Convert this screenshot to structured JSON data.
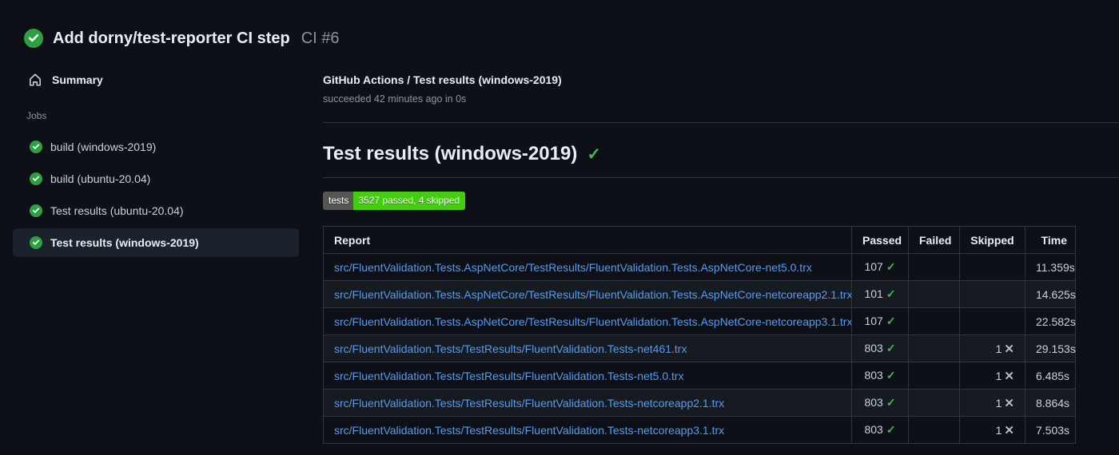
{
  "header": {
    "title": "Add dorny/test-reporter CI step",
    "run_label": "CI #6",
    "status": "success"
  },
  "sidebar": {
    "summary_label": "Summary",
    "jobs_label": "Jobs",
    "jobs": [
      {
        "label": "build (windows-2019)",
        "status": "success",
        "selected": false
      },
      {
        "label": "build (ubuntu-20.04)",
        "status": "success",
        "selected": false
      },
      {
        "label": "Test results (ubuntu-20.04)",
        "status": "success",
        "selected": false
      },
      {
        "label": "Test results (windows-2019)",
        "status": "success",
        "selected": true
      }
    ]
  },
  "main": {
    "breadcrumb": "GitHub Actions / Test results (windows-2019)",
    "status_line": "succeeded 42 minutes ago in 0s",
    "heading": "Test results (windows-2019)",
    "heading_check": "✓",
    "badge": {
      "label": "tests",
      "value": "3527 passed, 4 skipped"
    },
    "table": {
      "columns": [
        "Report",
        "Passed",
        "Failed",
        "Skipped",
        "Time"
      ],
      "pass_glyph": "✓",
      "skip_glyph": "✕",
      "rows": [
        {
          "report": "src/FluentValidation.Tests.AspNetCore/TestResults/FluentValidation.Tests.AspNetCore-net5.0.trx",
          "passed": "107",
          "failed": "",
          "skipped": "",
          "time": "11.359s"
        },
        {
          "report": "src/FluentValidation.Tests.AspNetCore/TestResults/FluentValidation.Tests.AspNetCore-netcoreapp2.1.trx",
          "passed": "101",
          "failed": "",
          "skipped": "",
          "time": "14.625s"
        },
        {
          "report": "src/FluentValidation.Tests.AspNetCore/TestResults/FluentValidation.Tests.AspNetCore-netcoreapp3.1.trx",
          "passed": "107",
          "failed": "",
          "skipped": "",
          "time": "22.582s"
        },
        {
          "report": "src/FluentValidation.Tests/TestResults/FluentValidation.Tests-net461.trx",
          "passed": "803",
          "failed": "",
          "skipped": "1",
          "time": "29.153s"
        },
        {
          "report": "src/FluentValidation.Tests/TestResults/FluentValidation.Tests-net5.0.trx",
          "passed": "803",
          "failed": "",
          "skipped": "1",
          "time": "6.485s"
        },
        {
          "report": "src/FluentValidation.Tests/TestResults/FluentValidation.Tests-netcoreapp2.1.trx",
          "passed": "803",
          "failed": "",
          "skipped": "1",
          "time": "8.864s"
        },
        {
          "report": "src/FluentValidation.Tests/TestResults/FluentValidation.Tests-netcoreapp3.1.trx",
          "passed": "803",
          "failed": "",
          "skipped": "1",
          "time": "7.503s"
        }
      ]
    }
  },
  "colors": {
    "success_green": "#2ea043",
    "check_green": "#3fb950",
    "badge_green": "#44cc11",
    "badge_gray": "#555555",
    "link_blue": "#539bf5",
    "border": "#30363d",
    "row_alt": "#161b22",
    "background": "#0d1117"
  }
}
